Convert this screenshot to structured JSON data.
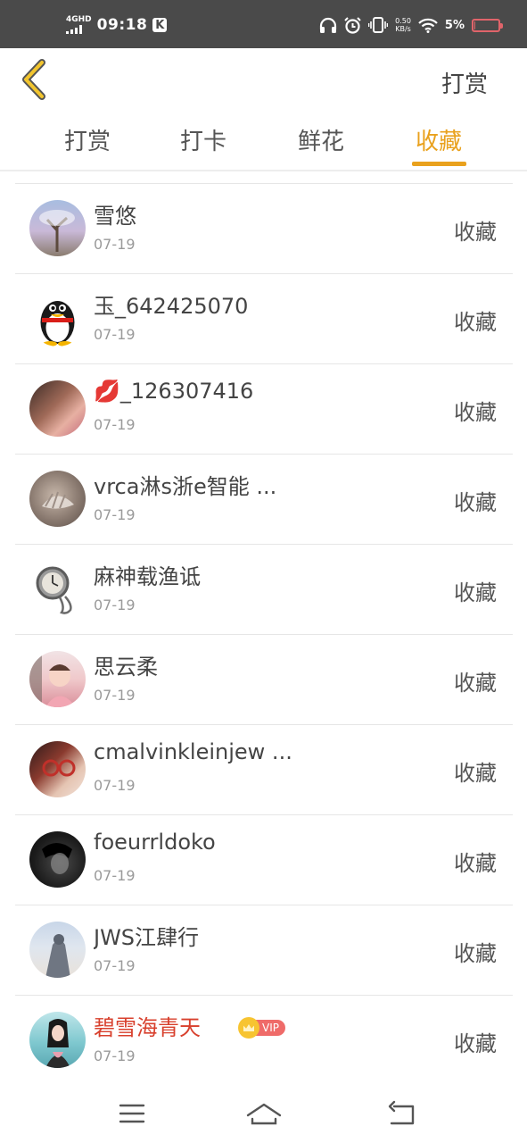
{
  "status_bar": {
    "network": "4GHD",
    "time": "09:18",
    "app_badge": "K",
    "speed_top": "0.50",
    "speed_bottom": "KB/s",
    "battery_text": "5%",
    "battery_level": 0.05,
    "battery_color": "#e0646a"
  },
  "header": {
    "back_icon": "chevron-left-icon",
    "action_label": "打赏"
  },
  "tabs": [
    {
      "label": "打赏",
      "active": false
    },
    {
      "label": "打卡",
      "active": false
    },
    {
      "label": "鲜花",
      "active": false
    },
    {
      "label": "收藏",
      "active": true
    }
  ],
  "accent_color": "#e9a11d",
  "list": [
    {
      "name": "雪悠",
      "date": "07-19",
      "action": "收藏"
    },
    {
      "name": "玉_642425070",
      "date": "07-19",
      "action": "收藏"
    },
    {
      "name": "💋_126307416",
      "date": "07-19",
      "action": "收藏"
    },
    {
      "name": "vrca淋s浙e智能 ...",
      "date": "07-19",
      "action": "收藏"
    },
    {
      "name": "麻神载渔诋",
      "date": "07-19",
      "action": "收藏"
    },
    {
      "name": "思云柔",
      "date": "07-19",
      "action": "收藏"
    },
    {
      "name": "cmalvinkleinjew ...",
      "date": "07-19",
      "action": "收藏"
    },
    {
      "name": "foeurrldoko",
      "date": "07-19",
      "action": "收藏"
    },
    {
      "name": "JWS江肆行",
      "date": "07-19",
      "action": "收藏"
    },
    {
      "name": "碧雪海青天",
      "date": "07-19",
      "action": "收藏",
      "vip_label": "VIP"
    }
  ],
  "nav": {
    "menu_icon": "menu-icon",
    "home_icon": "home-icon",
    "back_icon": "back-icon"
  }
}
